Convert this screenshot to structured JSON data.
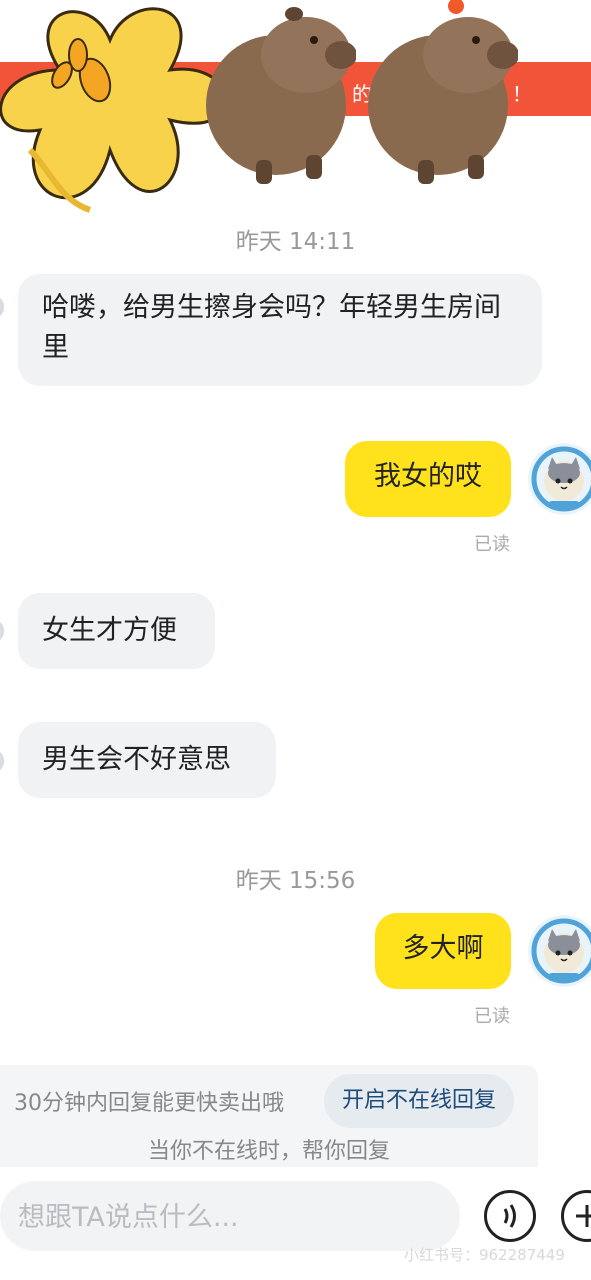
{
  "banner": {
    "text_left": "的",
    "text_right": "！",
    "color": "#f2543a"
  },
  "messages": {
    "time1": "昨天 14:11",
    "m1": "哈喽，给男生擦身会吗？年轻男生房间里",
    "m2": "我女的哎",
    "m2_read": "已读",
    "m3": "女生才方便",
    "m4": "男生会不好意思",
    "time2": "昨天 15:56",
    "m5": "多大啊",
    "m5_read": "已读"
  },
  "tip": {
    "line1": "30分钟内回复能更快卖出哦",
    "button": "开启不在线回复",
    "line2": "当你不在线时，帮你回复"
  },
  "composer": {
    "placeholder": "想跟TA说点什么..."
  },
  "icons": {
    "avatar": "cat-astronaut-avatar-icon",
    "voice": "voice-icon",
    "add": "plus-icon"
  },
  "watermark": "小红书号：962287449",
  "colors": {
    "incoming_bubble": "#f1f2f4",
    "outgoing_bubble": "#ffe11c",
    "link_blue": "#1f4b7a"
  }
}
